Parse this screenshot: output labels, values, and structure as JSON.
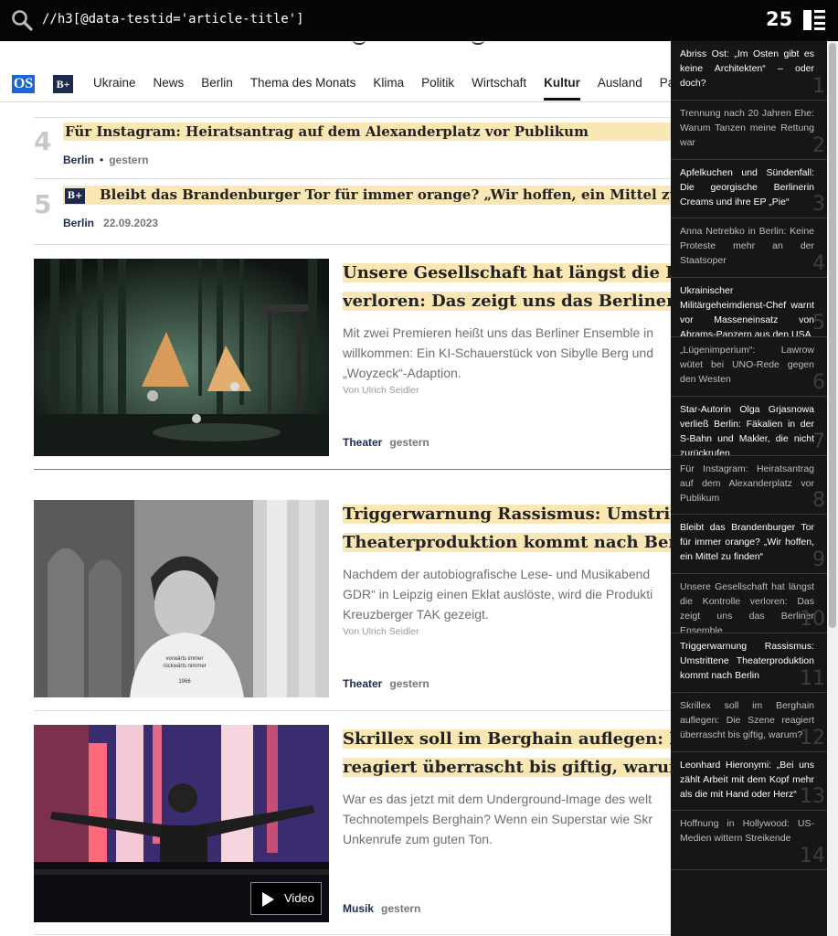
{
  "xpath_bar": {
    "query": "//h3[@data-testid='article-title']",
    "match_count": "25",
    "search_icon": "search-icon",
    "list_icon": "list-icon"
  },
  "nav": {
    "os_logo": "OS",
    "bplus_logo": "B+",
    "items": [
      "Ukraine",
      "News",
      "Berlin",
      "Thema des Monats",
      "Klima",
      "Politik",
      "Wirtschaft",
      "Kultur",
      "Ausland",
      "Pano"
    ],
    "active": "Kultur"
  },
  "ranking": [
    {
      "num": "4",
      "title": "Für Instagram: Heiratsantrag auf dem Alexanderplatz vor Publikum",
      "premium": false,
      "category": "Berlin",
      "date": "gestern"
    },
    {
      "num": "5",
      "title": "Bleibt das Brandenburger Tor für immer orange? „Wir hoffen, ein Mittel zu finde",
      "premium": true,
      "category": "Berlin",
      "date": "22.09.2023"
    }
  ],
  "articles": [
    {
      "headline_lines": [
        "Unsere Gesellschaft hat längst die Ko",
        "verloren: Das zeigt uns das Berliner E"
      ],
      "teaser_lines": [
        "Mit zwei Premieren heißt uns das Berliner Ensemble in",
        "willkommen: Ein KI-Schauerstück von Sibylle Berg und",
        "„Woyzeck“-Adaption."
      ],
      "author": "Von Ulrich Seidler",
      "category": "Theater",
      "date": "gestern",
      "video": ""
    },
    {
      "headline_lines": [
        "Triggerwarnung Rassismus: Umstritt",
        "Theaterproduktion kommt nach Berli"
      ],
      "teaser_lines": [
        "Nachdem der autobiografische Lese- und Musikabend",
        "GDR“ in Leipzig einen Eklat auslöste, wird die Produkti",
        "Kreuzberger TAK gezeigt."
      ],
      "author": "Von Ulrich Seidler",
      "category": "Theater",
      "date": "gestern",
      "video": "",
      "shirt_text": [
        "vorwärts immer",
        "rückwärts nimmer",
        "1966"
      ]
    },
    {
      "headline_lines": [
        "Skrillex soll im Berghain auflegen: Di",
        "reagiert überrascht bis giftig, warum"
      ],
      "teaser_lines": [
        "War es das jetzt mit dem Underground-Image des welt",
        "Technotempels Berghain? Wenn ein Superstar wie Skr",
        "Unkenrufe zum guten Ton."
      ],
      "author": "",
      "category": "Musik",
      "date": "gestern",
      "video": "Video"
    }
  ],
  "results": [
    {
      "n": "1",
      "text": "Abriss Ost: „Im Osten gibt es keine Architekten“ – oder doch?",
      "bright": true
    },
    {
      "n": "2",
      "text": "Trennung nach 20 Jahren Ehe: Warum Tanzen meine Rettung war",
      "bright": false
    },
    {
      "n": "3",
      "text": "Apfelkuchen und Sündenfall: Die georgische Berlinerin Creams und ihre EP „Pie“",
      "bright": true
    },
    {
      "n": "4",
      "text": "Anna Netrebko in Berlin: Keine Proteste mehr an der Staatsoper",
      "bright": false
    },
    {
      "n": "5",
      "text": "Ukrainischer Militärgeheimdienst-Chef warnt vor Masseneinsatz von Abrams-Panzern aus den USA",
      "bright": true
    },
    {
      "n": "6",
      "text": "„Lügenimperium“: Lawrow wütet bei UNO-Rede gegen den Westen",
      "bright": false
    },
    {
      "n": "7",
      "text": "Star-Autorin Olga Grjasnowa verließ Berlin: Fäkalien in der S-Bahn und Makler, die nicht zurückrufen",
      "bright": true
    },
    {
      "n": "8",
      "text": "Für Instagram: Heiratsantrag auf dem Alexanderplatz vor Publikum",
      "bright": false
    },
    {
      "n": "9",
      "text": "Bleibt das Brandenburger Tor für immer orange? „Wir hoffen, ein Mittel zu finden“",
      "bright": true
    },
    {
      "n": "10",
      "text": "Unsere Gesellschaft hat längst die Kontrolle verloren: Das zeigt uns das Berliner Ensemble",
      "bright": false
    },
    {
      "n": "11",
      "text": "Triggerwarnung Rassismus: Umstrittene Theaterproduktion kommt nach Berlin",
      "bright": true
    },
    {
      "n": "12",
      "text": "Skrillex soll im Berghain auflegen: Die Szene reagiert überrascht bis giftig, warum?",
      "bright": false
    },
    {
      "n": "13",
      "text": "Leonhard Hieronymi: „Bei uns zählt Arbeit mit dem Kopf mehr als die mit Hand oder Herz“",
      "bright": true
    },
    {
      "n": "14",
      "text": "Hoffnung in Hollywood: US-Medien wittern Streikende",
      "bright": false
    }
  ]
}
